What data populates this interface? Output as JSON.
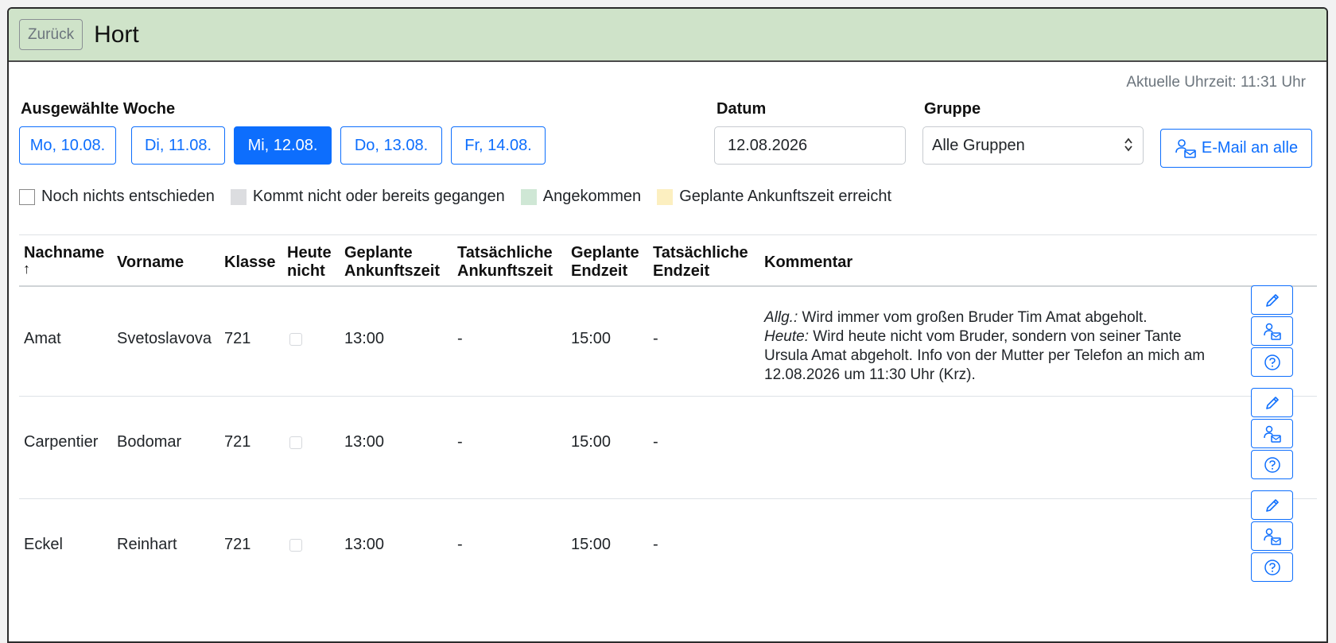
{
  "header": {
    "back_label": "Zurück",
    "title": "Hort"
  },
  "clock": "Aktuelle Uhrzeit: 11:31 Uhr",
  "week": {
    "label": "Ausgewählte Woche",
    "days": [
      "Mo, 10.08.",
      "Di, 11.08.",
      "Mi, 12.08.",
      "Do, 13.08.",
      "Fr, 14.08."
    ],
    "selected": "Mi, 12.08."
  },
  "date": {
    "label": "Datum",
    "value": "12.08.2026"
  },
  "group": {
    "label": "Gruppe",
    "value": "Alle Gruppen"
  },
  "mail_all_label": "E-Mail an alle",
  "legend": [
    {
      "label": "Noch nichts entschieden",
      "color": "#ffffff"
    },
    {
      "label": "Kommt nicht oder bereits gegangen",
      "color": "#dcdde0"
    },
    {
      "label": "Angekommen",
      "color": "#cfe7d5"
    },
    {
      "label": "Geplante Ankunftszeit erreicht",
      "color": "#fcefc0"
    }
  ],
  "table": {
    "headers": {
      "nachname": "Nachname",
      "sort_arrow": "↑",
      "vorname": "Vorname",
      "klasse": "Klasse",
      "heute1": "Heute",
      "heute2": "nicht",
      "gan1": "Geplante",
      "gan2": "Ankunftszeit",
      "tan1": "Tatsächliche",
      "tan2": "Ankunftszeit",
      "gen1": "Geplante",
      "gen2": "Endzeit",
      "ten1": "Tatsächliche",
      "ten2": "Endzeit",
      "kommentar": "Kommentar"
    },
    "rows": [
      {
        "nachname": "Amat",
        "vorname": "Svetoslavova",
        "klasse": "721",
        "geplante_ankunft": "13:00",
        "tatsaechliche_ankunft": "-",
        "geplante_ende": "15:00",
        "tatsaechliche_ende": "-",
        "comment_allg_label": "Allg.:",
        "comment_allg": " Wird immer vom großen Bruder Tim Amat abgeholt.",
        "comment_heute_label": "Heute:",
        "comment_heute": " Wird heute nicht vom Bruder, sondern von seiner Tante Ursula Amat abgeholt. Info von der Mutter per Telefon an mich am 12.08.2026 um 11:30 Uhr (Krz)."
      },
      {
        "nachname": "Carpentier",
        "vorname": "Bodomar",
        "klasse": "721",
        "geplante_ankunft": "13:00",
        "tatsaechliche_ankunft": "-",
        "geplante_ende": "15:00",
        "tatsaechliche_ende": "-"
      },
      {
        "nachname": "Eckel",
        "vorname": "Reinhart",
        "klasse": "721",
        "geplante_ankunft": "13:00",
        "tatsaechliche_ankunft": "-",
        "geplante_ende": "15:00",
        "tatsaechliche_ende": "-"
      }
    ]
  },
  "icons": {
    "edit": "pencil-icon",
    "mail": "person-mail-icon",
    "help": "question-circle-icon"
  },
  "colors": {
    "accent": "#0d6efd",
    "header_bg": "#cfe3c9"
  }
}
